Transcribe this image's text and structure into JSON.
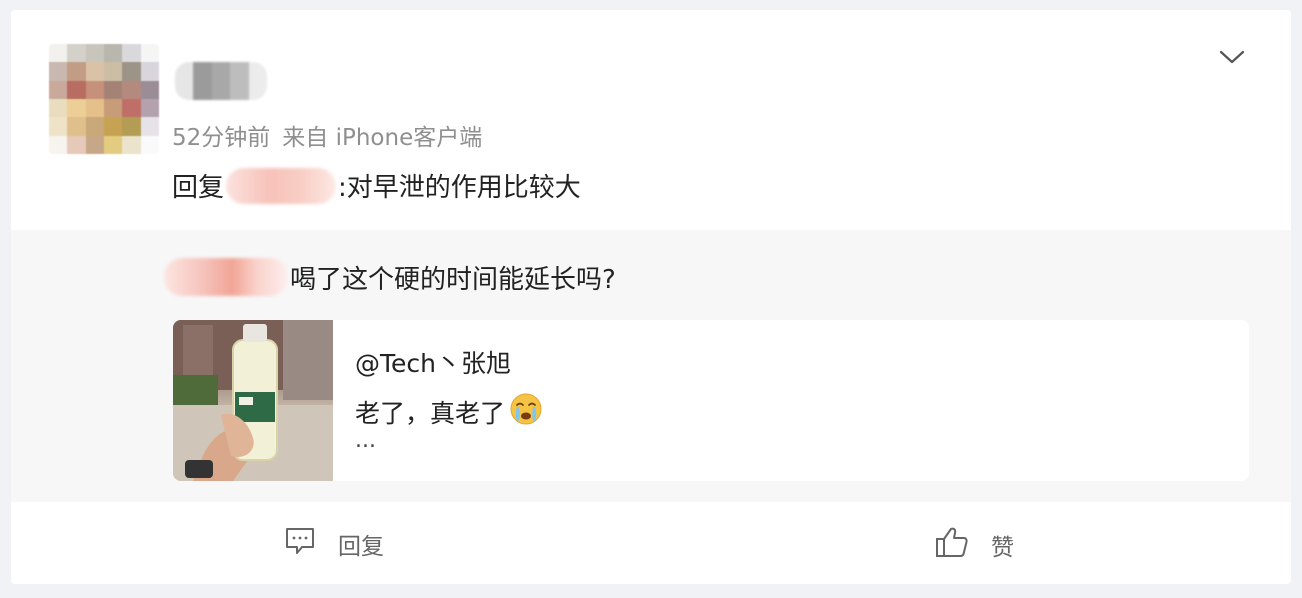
{
  "post": {
    "time": "52分钟前",
    "source": "来自 iPhone客户端",
    "reply_prefix": "回复",
    "reply_text": ":对早泄的作用比较大"
  },
  "quoted": {
    "text": "喝了这个硬的时间能延长吗?",
    "card": {
      "author": "@Tech丶张旭",
      "text": "老了，真老了",
      "more": "...",
      "emoji": "crying-face-icon"
    }
  },
  "actions": {
    "reply_label": "回复",
    "like_label": "赞"
  },
  "icons": {
    "menu": "chevron-down-icon",
    "reply": "comment-icon",
    "like": "thumbs-up-icon"
  }
}
